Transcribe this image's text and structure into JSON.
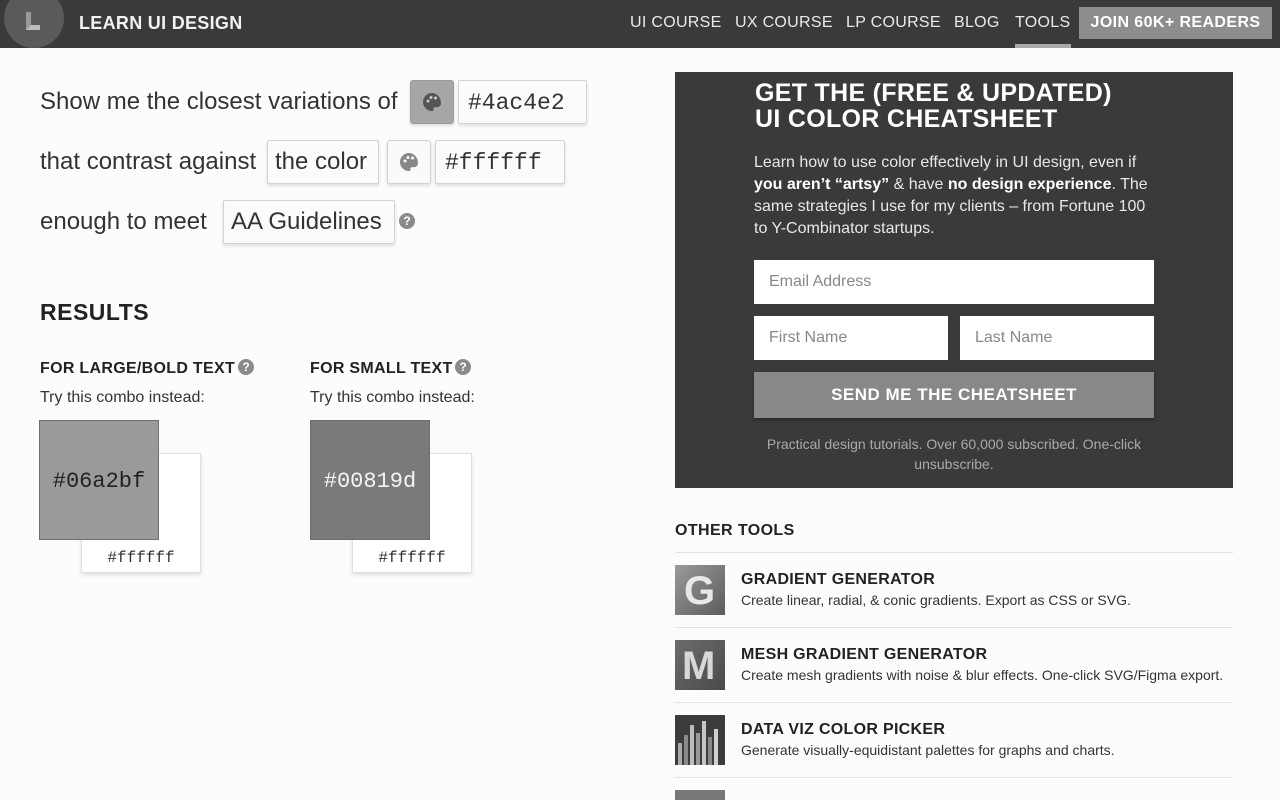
{
  "header": {
    "brand": "LEARN UI DESIGN",
    "nav": [
      "UI COURSE",
      "UX COURSE",
      "LP COURSE",
      "BLOG",
      "TOOLS"
    ],
    "active_nav": "TOOLS",
    "join_label": "JOIN 60K+ READERS"
  },
  "form": {
    "line1": "Show me the closest variations of",
    "color1": "#4ac4e2",
    "line2": "that contrast against",
    "against_select": "the color",
    "color2": "#ffffff",
    "line3": "enough to meet",
    "guideline_select": "AA Guidelines",
    "help": "?"
  },
  "results": {
    "title": "RESULTS",
    "groups": [
      {
        "heading": "FOR LARGE/BOLD TEXT",
        "subtext": "Try this combo instead:",
        "foreground": "#06a2bf",
        "background": "#ffffff"
      },
      {
        "heading": "FOR SMALL TEXT",
        "subtext": "Try this combo instead:",
        "foreground": "#00819d",
        "background": "#ffffff"
      }
    ]
  },
  "promo": {
    "title_line1": "GET THE (FREE & UPDATED)",
    "title_line2": "UI COLOR CHEATSHEET",
    "body_1": "Learn how to use color effectively in UI design, even if ",
    "body_bold1": "you aren’t “artsy”",
    "body_2": " & have ",
    "body_bold2": "no design experience",
    "body_3": ". The same strategies I use for my clients – from Fortune 100 to Y-Combinator startups.",
    "email_placeholder": "Email Address",
    "first_placeholder": "First Name",
    "last_placeholder": "Last Name",
    "cta": "SEND ME THE CHEATSHEET",
    "footer": "Practical design tutorials. Over 60,000 subscribed. One-click unsubscribe."
  },
  "other_tools": {
    "title": "OTHER TOOLS",
    "items": [
      {
        "title": "GRADIENT GENERATOR",
        "desc": "Create linear, radial, & conic gradients. Export as CSS or SVG.",
        "icon": "gradient-generator-icon",
        "icon_letter": "G"
      },
      {
        "title": "MESH GRADIENT GENERATOR",
        "desc": "Create mesh gradients with noise & blur effects. One-click SVG/Figma export.",
        "icon": "mesh-gradient-icon",
        "icon_letter": "M"
      },
      {
        "title": "DATA VIZ COLOR PICKER",
        "desc": "Generate visually-equidistant palettes for graphs and charts.",
        "icon": "bar-chart-icon"
      }
    ]
  }
}
